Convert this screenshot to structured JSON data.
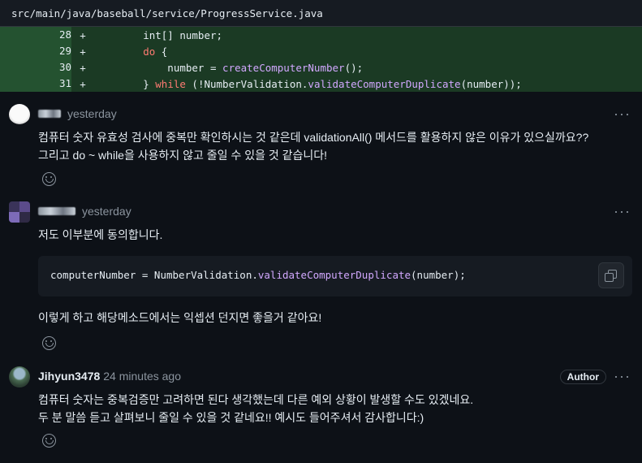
{
  "file": {
    "path": "src/main/java/baseball/service/ProgressService.java"
  },
  "diff": [
    {
      "line": "28",
      "marker": "+",
      "parts": [
        {
          "t": "        int[] number;",
          "c": ""
        }
      ]
    },
    {
      "line": "29",
      "marker": "+",
      "parts": [
        {
          "t": "        ",
          "c": ""
        },
        {
          "t": "do",
          "c": "kw"
        },
        {
          "t": " {",
          "c": ""
        }
      ]
    },
    {
      "line": "30",
      "marker": "+",
      "parts": [
        {
          "t": "            number = ",
          "c": ""
        },
        {
          "t": "createComputerNumber",
          "c": "fn"
        },
        {
          "t": "();",
          "c": ""
        }
      ]
    },
    {
      "line": "31",
      "marker": "+",
      "parts": [
        {
          "t": "        } ",
          "c": ""
        },
        {
          "t": "while",
          "c": "kw"
        },
        {
          "t": " (!NumberValidation.",
          "c": ""
        },
        {
          "t": "validateComputerDuplicate",
          "c": "fn"
        },
        {
          "t": "(number));",
          "c": ""
        }
      ]
    }
  ],
  "comments": [
    {
      "time": "yesterday",
      "lines": [
        "컴퓨터 숫자 유효성 검사에 중복만 확인하시는 것 같은데 validationAll() 메서드를 활용하지 않은 이유가 있으실까요??",
        "그리고 do ~ while을 사용하지 않고 줄일 수 있을 것 같습니다!"
      ]
    },
    {
      "time": "yesterday",
      "intro": "저도 이부분에 동의합니다.",
      "code_parts": [
        {
          "t": "computerNumber = NumberValidation.",
          "c": ""
        },
        {
          "t": "validateComputerDuplicate",
          "c": "fn"
        },
        {
          "t": "(number);",
          "c": ""
        }
      ],
      "outro": "이렇게 하고 해당메소드에서는 익셉션 던지면 좋을거 같아요!"
    },
    {
      "username": "Jihyun3478",
      "time": "24 minutes ago",
      "badge": "Author",
      "lines": [
        "컴퓨터 숫자는 중복검증만 고려하면 된다 생각했는데 다른 예외 상황이 발생할 수도 있겠네요.",
        "두 분 말씀 듣고 살펴보니 줄일 수 있을 것 같네요!! 예시도 들어주셔서 감사합니다:)"
      ]
    }
  ],
  "menu_glyph": "···"
}
